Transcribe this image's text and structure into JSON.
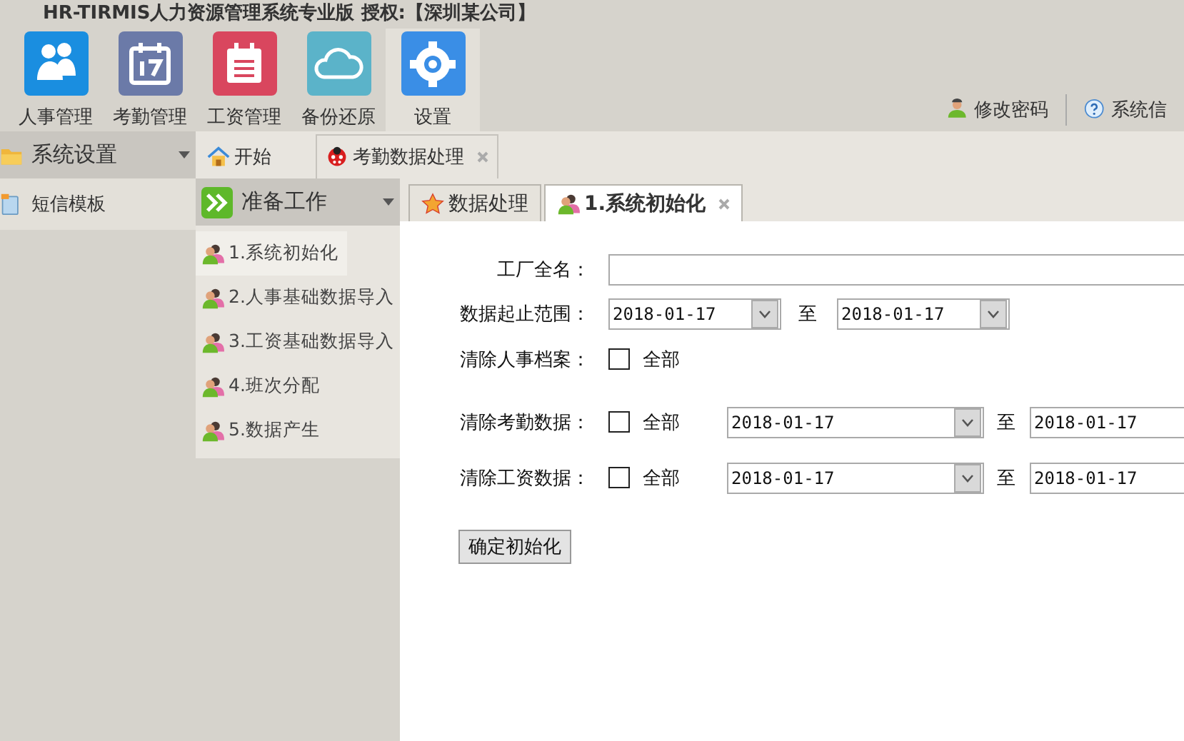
{
  "app_title": "HR-TIRMIS人力资源管理系统专业版 授权:【深圳某公司】",
  "toolbar": [
    {
      "label": "人事管理",
      "color": "#1a8ee0",
      "selected": false
    },
    {
      "label": "考勤管理",
      "color": "#6b7aa8",
      "selected": false
    },
    {
      "label": "工资管理",
      "color": "#d9465e",
      "selected": false
    },
    {
      "label": "备份还原",
      "color": "#5bb3c9",
      "selected": false
    },
    {
      "label": "设置",
      "color": "#3a8ee6",
      "selected": true
    }
  ],
  "user_links": [
    {
      "label": "修改密码"
    },
    {
      "label": "系统信"
    }
  ],
  "left_panel": {
    "title": "系统设置",
    "items": [
      {
        "label": "短信模板"
      }
    ]
  },
  "tabs": [
    {
      "label": "开始",
      "selected": false,
      "closable": false
    },
    {
      "label": "考勤数据处理",
      "selected": true,
      "closable": true
    }
  ],
  "nav_panel": {
    "title": "准备工作",
    "items": [
      {
        "label": "1.系统初始化",
        "selected": true
      },
      {
        "label": "2.人事基础数据导入",
        "selected": false
      },
      {
        "label": "3.工资基础数据导入",
        "selected": false
      },
      {
        "label": "4.班次分配",
        "selected": false
      },
      {
        "label": "5.数据产生",
        "selected": false
      }
    ]
  },
  "sub_tabs": [
    {
      "label": "数据处理",
      "selected": false,
      "closable": false
    },
    {
      "label": "1.系统初始化",
      "selected": true,
      "closable": true
    }
  ],
  "form": {
    "rows": [
      {
        "kind": "text",
        "label": "工厂全名："
      },
      {
        "kind": "range",
        "label": "数据起止范围：",
        "from": "2018-01-17",
        "separator": "至",
        "to": "2018-01-17"
      },
      {
        "kind": "check",
        "label": "清除人事档案：",
        "check_label": "全部",
        "checked": false
      },
      {
        "kind": "check_range",
        "label": "清除考勤数据：",
        "check_label": "全部",
        "checked": false,
        "from": "2018-01-17",
        "separator": "至",
        "to": "2018-01-17"
      },
      {
        "kind": "check_range",
        "label": "清除工资数据：",
        "check_label": "全部",
        "checked": false,
        "from": "2018-01-17",
        "separator": "至",
        "to": "2018-01-17"
      }
    ],
    "submit": "确定初始化"
  }
}
